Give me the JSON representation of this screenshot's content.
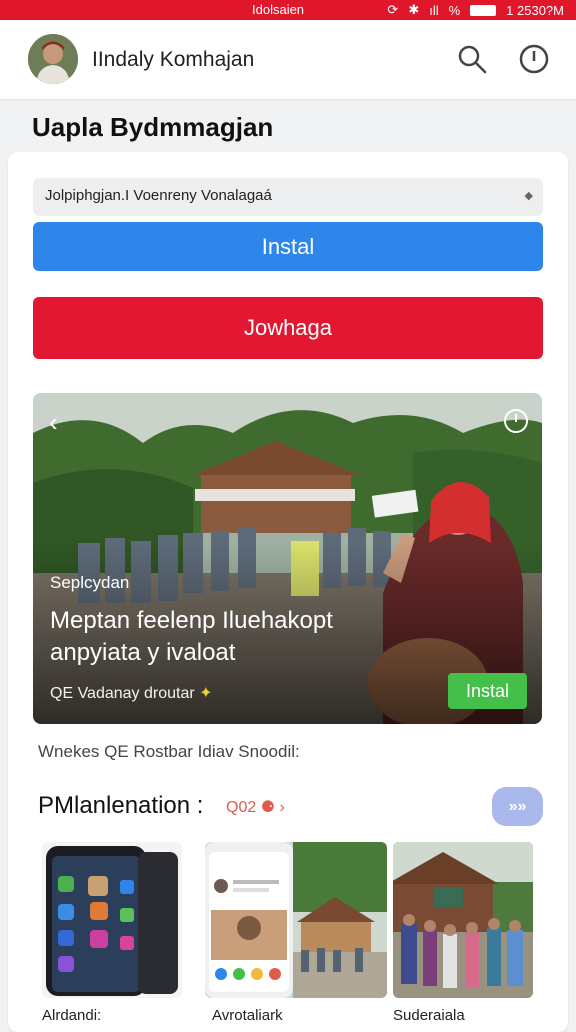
{
  "status_bar": {
    "title": "Idolsaien",
    "time": "1 2530?M",
    "battery_text": "%"
  },
  "header": {
    "user_name": "IIndaly Komhajan"
  },
  "page": {
    "title": "Uapla Bydmmagjan"
  },
  "form": {
    "select_value": "Jolpiphgjan.I Voenreny Vonalagaá",
    "install_label": "Instal",
    "red_button_label": "Jowhaga"
  },
  "hero": {
    "kicker": "Seplcydan",
    "headline": "Meptan feelenp Iluehakopt anpyiata y ivaloat",
    "meta": "QE Vadanay droutar",
    "meta_star": "✦",
    "cta_label": "Instal"
  },
  "caption": "Wnekes QE Rostbar Idiav Snoodil:",
  "section": {
    "title": "PMlanlenation :",
    "tag": "Q02 ⚈ ›",
    "button_label": "»»"
  },
  "thumbnails": [
    {
      "label": "Alrdandi:"
    },
    {
      "label": "Avrotaliark"
    },
    {
      "label": "Suderaiala"
    }
  ],
  "colors": {
    "brand_red": "#e21832",
    "install_blue": "#2f86ea",
    "hero_green": "#44c04a",
    "section_blue": "#a9b9ec"
  },
  "icons": [
    "search-icon",
    "info-icon",
    "back-arrow-icon",
    "timer-icon",
    "wifi-icon",
    "bluetooth-icon",
    "signal-icon",
    "battery-icon"
  ]
}
